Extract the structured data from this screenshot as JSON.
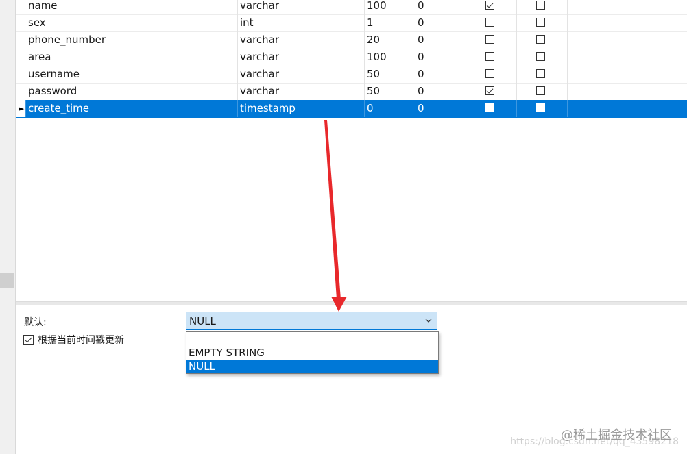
{
  "table": {
    "rows": [
      {
        "name": "name",
        "type": "varchar",
        "length": "100",
        "decimals": "0",
        "not_null": true,
        "key": false,
        "selected": false
      },
      {
        "name": "sex",
        "type": "int",
        "length": "1",
        "decimals": "0",
        "not_null": false,
        "key": false,
        "selected": false
      },
      {
        "name": "phone_number",
        "type": "varchar",
        "length": "20",
        "decimals": "0",
        "not_null": false,
        "key": false,
        "selected": false
      },
      {
        "name": "area",
        "type": "varchar",
        "length": "100",
        "decimals": "0",
        "not_null": false,
        "key": false,
        "selected": false
      },
      {
        "name": "username",
        "type": "varchar",
        "length": "50",
        "decimals": "0",
        "not_null": false,
        "key": false,
        "selected": false
      },
      {
        "name": "password",
        "type": "varchar",
        "length": "50",
        "decimals": "0",
        "not_null": true,
        "key": false,
        "selected": false
      },
      {
        "name": "create_time",
        "type": "timestamp",
        "length": "0",
        "decimals": "0",
        "not_null": false,
        "key": false,
        "selected": true
      }
    ],
    "row_indicator": "►"
  },
  "properties": {
    "default_label": "默认:",
    "default_value": "NULL",
    "update_checkbox_label": "根据当前时间戳更新",
    "update_checkbox_checked": true
  },
  "dropdown": {
    "options": [
      "",
      "EMPTY STRING",
      "NULL"
    ],
    "selected": "NULL"
  },
  "watermark": {
    "text": "@稀土掘金技术社区",
    "url": "https://blog.csdn.net/qq_43598218"
  },
  "colors": {
    "selection": "#0078d7",
    "combo_bg": "#cce4f7",
    "arrow": "#e8282b"
  }
}
